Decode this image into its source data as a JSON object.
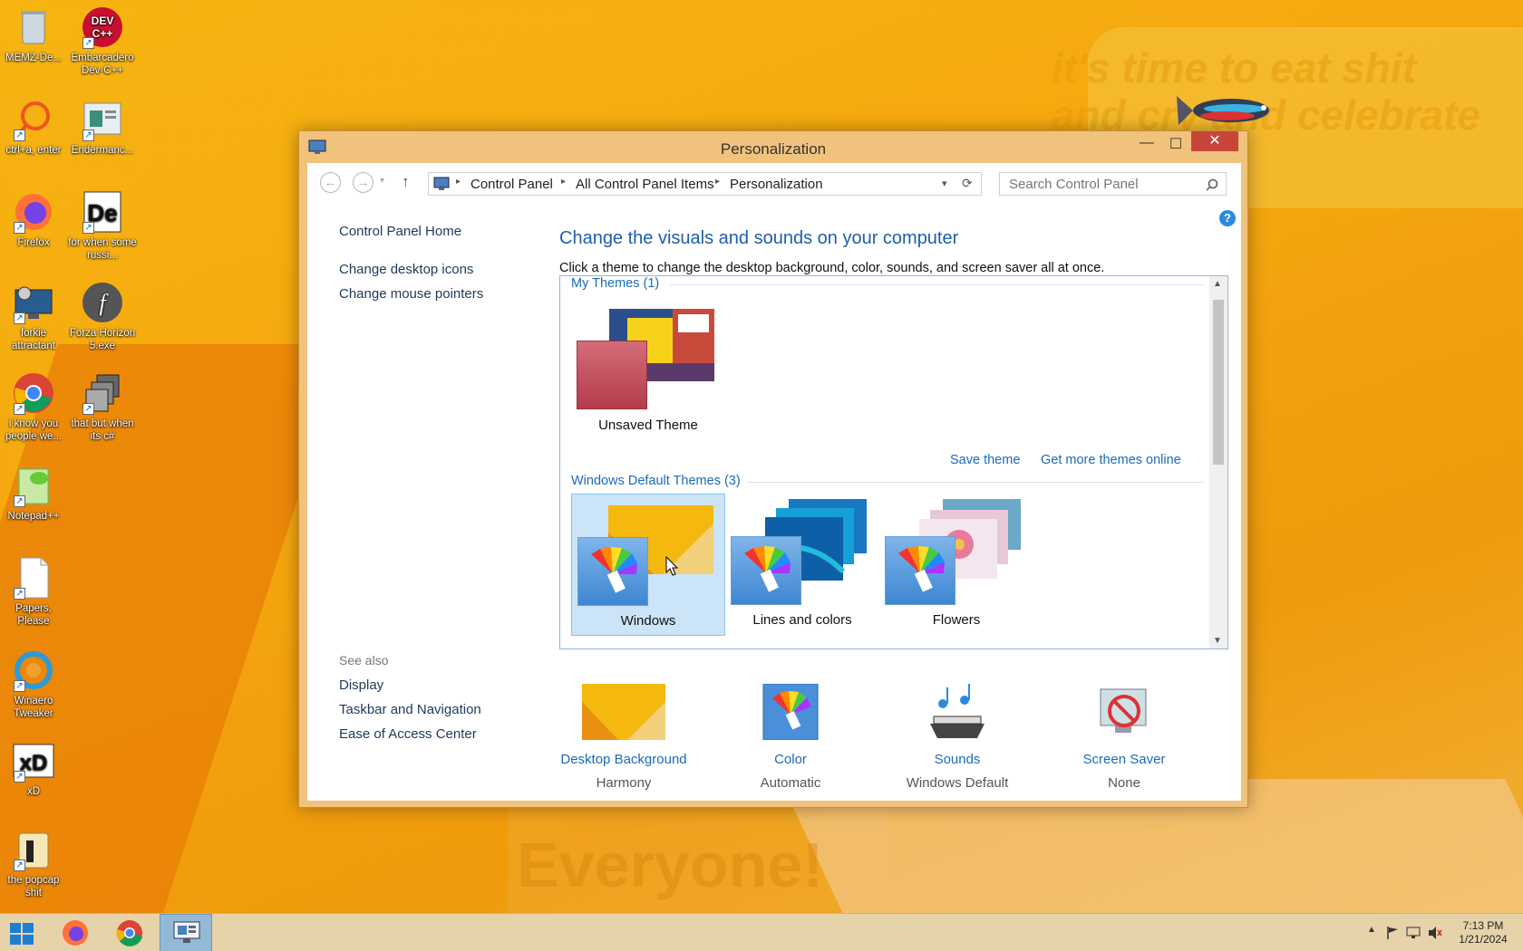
{
  "desktop": {
    "overlay_lines": [
      "it's time to eat shit",
      "and cry and celebrate"
    ],
    "overlay_bottom": "Everyone!",
    "icons": [
      {
        "label": "MEMZ-De..."
      },
      {
        "label": "Embarcadero Dev-C++"
      },
      {
        "label": "ctrl+a, enter"
      },
      {
        "label": "Endermanc..."
      },
      {
        "label": "Firefox"
      },
      {
        "label": "for when some russi..."
      },
      {
        "label": "forkie attractant"
      },
      {
        "label": "Forza Horizon 5.exe"
      },
      {
        "label": "i know you people we..."
      },
      {
        "label": "that but when its c#"
      },
      {
        "label": "Notepad++"
      },
      {
        "label": "Papers, Please"
      },
      {
        "label": "Winaero Tweaker"
      },
      {
        "label": "xD"
      },
      {
        "label": "the popcap shit"
      }
    ]
  },
  "window": {
    "title": "Personalization",
    "controls": {
      "minimize": "—",
      "maximize": "☐",
      "close": "✕"
    }
  },
  "navbar": {
    "back": "←",
    "forward": "→",
    "up": "↑",
    "breadcrumb": [
      "Control Panel",
      "All Control Panel Items",
      "Personalization"
    ],
    "search_placeholder": "Search Control Panel"
  },
  "left_pane": {
    "home": "Control Panel Home",
    "links": [
      "Change desktop icons",
      "Change mouse pointers"
    ],
    "see_also_label": "See also",
    "see_also": [
      "Display",
      "Taskbar and Navigation",
      "Ease of Access Center"
    ]
  },
  "main": {
    "heading": "Change the visuals and sounds on your computer",
    "subtext": "Click a theme to change the desktop background, color, sounds, and screen saver all at once.",
    "my_themes_header": "My Themes (1)",
    "unsaved_theme": "Unsaved Theme",
    "save_theme": "Save theme",
    "get_more": "Get more themes online",
    "default_header": "Windows Default Themes (3)",
    "default_themes": [
      "Windows",
      "Lines and colors",
      "Flowers"
    ],
    "selected_theme": "Windows"
  },
  "bottom": [
    {
      "title": "Desktop Background",
      "value": "Harmony"
    },
    {
      "title": "Color",
      "value": "Automatic"
    },
    {
      "title": "Sounds",
      "value": "Windows Default"
    },
    {
      "title": "Screen Saver",
      "value": "None"
    }
  ],
  "taskbar": {
    "time": "7:13 PM",
    "date": "1/21/2024"
  },
  "colors": {
    "accent": "#1a6bbb",
    "close": "#c7453a",
    "window_frame": "#f1c27c"
  }
}
